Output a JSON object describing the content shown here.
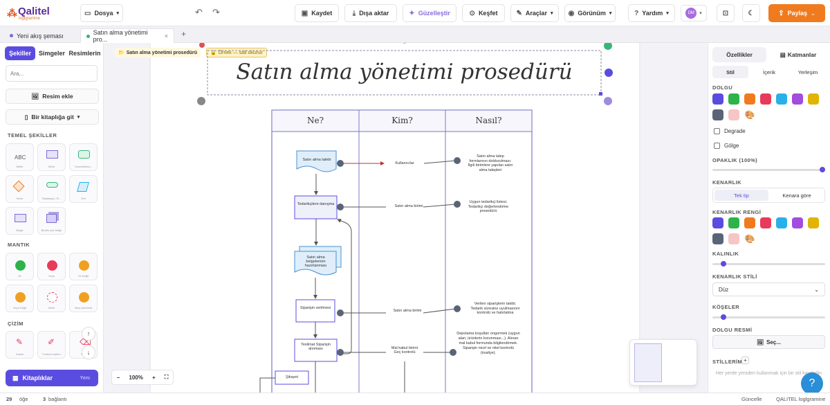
{
  "header": {
    "logo_text": "Qalitel",
    "logo_sub": "loglgramine",
    "file_menu": "Dosya",
    "save": "Kaydet",
    "export": "Dışa aktar",
    "beautify": "Güzelleştir",
    "explore": "Keşfet",
    "tools": "Araçlar",
    "view": "Görünüm",
    "help": "Yardım",
    "avatar": "DM",
    "share": "Paylaş"
  },
  "tabs": [
    {
      "label": "Yeni akış şeması",
      "color": "#7a6bd8"
    },
    {
      "label": "Satın alma yönetimi pro...",
      "color": "#3ab57a"
    }
  ],
  "left": {
    "tab_shapes": "Şekiller",
    "tab_symbols": "Simgeler",
    "tab_images": "Resimlerin",
    "search_placeholder": "Ara...",
    "add_image": "Resim ekle",
    "go_library": "Bir kitaplığa git",
    "sec_basic": "TEMEL ŞEKİLLER",
    "sec_logic": "MANTIK",
    "sec_draw": "ÇİZİM",
    "basic_tiles": [
      "Metin",
      "Birim",
      "Yuvarlatılmış...",
      "Karar",
      "Başlangıç / B...",
      "Veri",
      "Belge",
      "Birden çok belge"
    ],
    "logic_tiles": [
      "Ve",
      "Veya",
      "Ve Değil",
      "Veya Değil",
      "Daire",
      "Veya (sembol)"
    ],
    "draw_tiles": [
      "Kalem",
      "Fosforlu kalem",
      "Silgi"
    ],
    "libraries": "Kitaplıklar",
    "libraries_new": "Yeni"
  },
  "canvas": {
    "chip1": "Satın alma yönetimi prosedürü",
    "chip2": "Örnek — salt okunur",
    "title": "Satın alma yönetimi prosedürü",
    "headers": [
      "Ne?",
      "Kim?",
      "Nasıl?"
    ],
    "who": [
      "Kullanıcılar",
      "Satın alma birimi",
      "Satın alma birimi",
      "Mal kabul birimi\nGeç kontrolü"
    ],
    "how": [
      "Satın alma talep formlarının doldurulması: İlgili birimlere yapılan satın alma talepleri",
      "Uygun tedarikçi listesi. Tedarikçi değerlendirme prosedürü",
      "Verilen siparişlerin takibi. Tedarik süresine uyulmasının kontrolü ve hatırlatma",
      "Depolama koşulları ongormek (uygun alan, ürünlerin korunması...). Alınan mal kabul formunda bilgilendirmek. Siparişin nicel ve nitel kontrolü (irsaliye)."
    ],
    "steps": [
      "Satın alma talebi",
      "Tedarikçilere danışma",
      "Satın alma belgelerinin hazırlanması",
      "Siparişin verilmesi",
      "Teslimat Siparişin alınması",
      "Şikayet"
    ],
    "zoom": "100%"
  },
  "right": {
    "tab_props": "Özellikler",
    "tab_layers": "Katmanlar",
    "sub_style": "Stil",
    "sub_content": "İçerik",
    "sub_place": "Yerleşim",
    "fill": "DOLGU",
    "gradient": "Degrade",
    "shadow": "Gölge",
    "opacity": "OPAKLIK (100%)",
    "border": "KENARLIK",
    "border_single": "Tek tip",
    "border_by_edge": "Kenara göre",
    "border_color": "KENARLIK RENGİ",
    "thickness": "KALINLIK",
    "border_style": "KENARLIK STİLİ",
    "border_style_value": "Düz",
    "corners": "KÖŞELER",
    "fill_image": "DOLGU RESMİ",
    "choose": "Seç...",
    "styles": "STİLLERİM",
    "styles_hint": "Her yerde yeniden kullanmak için bir stil kaydedin",
    "palette": [
      "#5b4ce0",
      "#2db34a",
      "#f07b1f",
      "#e83a5a",
      "#2ab0e8",
      "#a34ce0",
      "#e0b400",
      "#5a6478",
      "#f6c5c5"
    ]
  },
  "status": {
    "zoom_val": "29",
    "zoom_unit": "öğe",
    "count_val": "3",
    "count_unit": "bağlantı",
    "updated": "Güncelle",
    "brand": "QALITEL loglgramine"
  }
}
